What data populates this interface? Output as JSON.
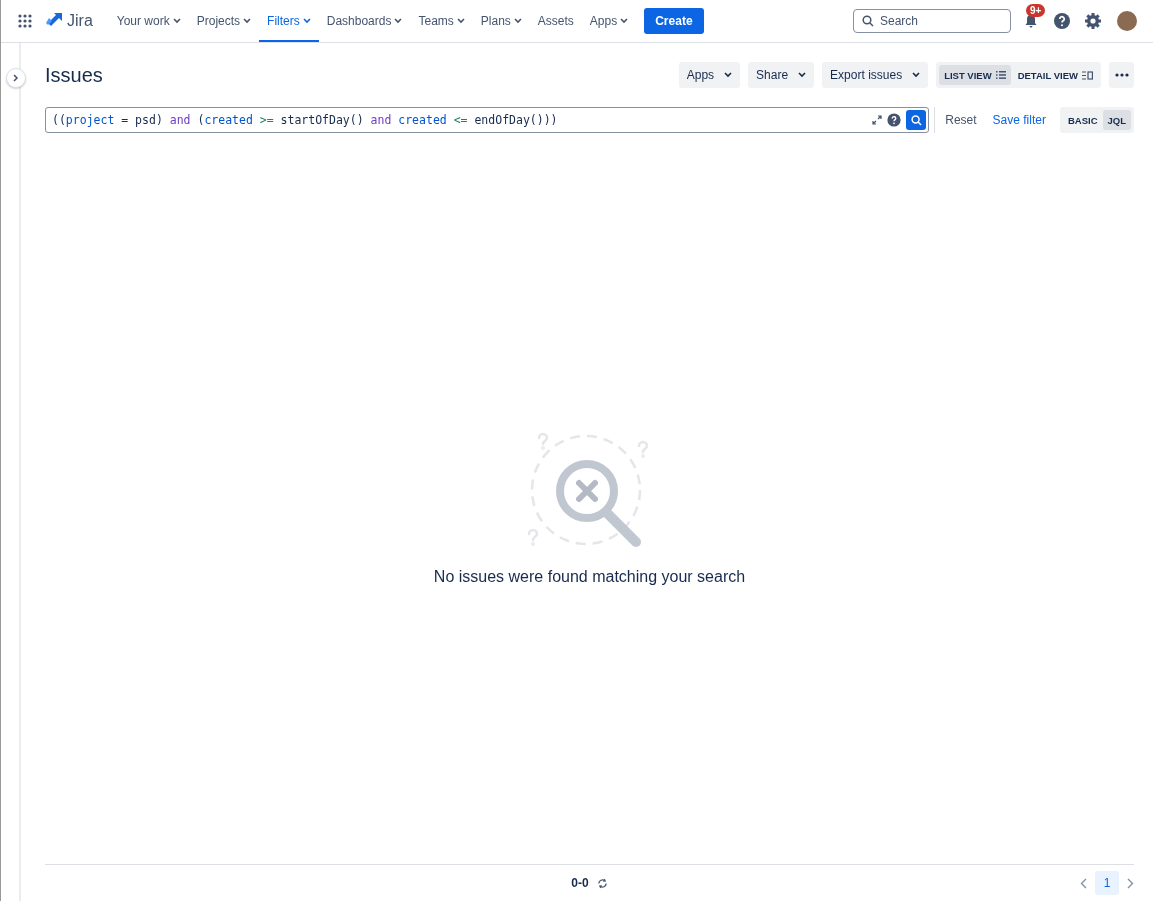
{
  "nav": {
    "logo": "Jira",
    "items": [
      {
        "label": "Your work",
        "selected": false,
        "dropdown": true
      },
      {
        "label": "Projects",
        "selected": false,
        "dropdown": true
      },
      {
        "label": "Filters",
        "selected": true,
        "dropdown": true
      },
      {
        "label": "Dashboards",
        "selected": false,
        "dropdown": true
      },
      {
        "label": "Teams",
        "selected": false,
        "dropdown": true
      },
      {
        "label": "Plans",
        "selected": false,
        "dropdown": true
      },
      {
        "label": "Assets",
        "selected": false,
        "dropdown": false
      },
      {
        "label": "Apps",
        "selected": false,
        "dropdown": true
      }
    ],
    "create": "Create",
    "search": {
      "placeholder": "Search"
    },
    "notifications": "9+"
  },
  "page": {
    "title": "Issues",
    "actions": [
      {
        "label": "Apps"
      },
      {
        "label": "Share"
      },
      {
        "label": "Export issues"
      }
    ],
    "views": [
      {
        "label": "LIST VIEW",
        "kind": "list",
        "selected": true
      },
      {
        "label": "DETAIL VIEW",
        "kind": "detail",
        "selected": false
      }
    ]
  },
  "query": {
    "tokens": [
      {
        "text": "((",
        "kind": "plain"
      },
      {
        "text": "project",
        "kind": "field"
      },
      {
        "text": " = ",
        "kind": "plain"
      },
      {
        "text": "psd) ",
        "kind": "plain"
      },
      {
        "text": "and",
        "kind": "keyword"
      },
      {
        "text": " (",
        "kind": "plain"
      },
      {
        "text": "created",
        "kind": "field"
      },
      {
        "text": " >= ",
        "kind": "operator"
      },
      {
        "text": "startOfDay() ",
        "kind": "plain"
      },
      {
        "text": "and",
        "kind": "keyword"
      },
      {
        "text": " created",
        "kind": "field"
      },
      {
        "text": " <= ",
        "kind": "operator"
      },
      {
        "text": "endOfDay()))",
        "kind": "plain"
      }
    ],
    "reset": "Reset",
    "save": "Save filter",
    "modes": [
      {
        "label": "BASIC",
        "selected": false
      },
      {
        "label": "JQL",
        "selected": true
      }
    ]
  },
  "empty": {
    "message": "No issues were found matching your search"
  },
  "footer": {
    "count": "0-0",
    "pages": [
      {
        "label": "1",
        "selected": true
      }
    ]
  }
}
